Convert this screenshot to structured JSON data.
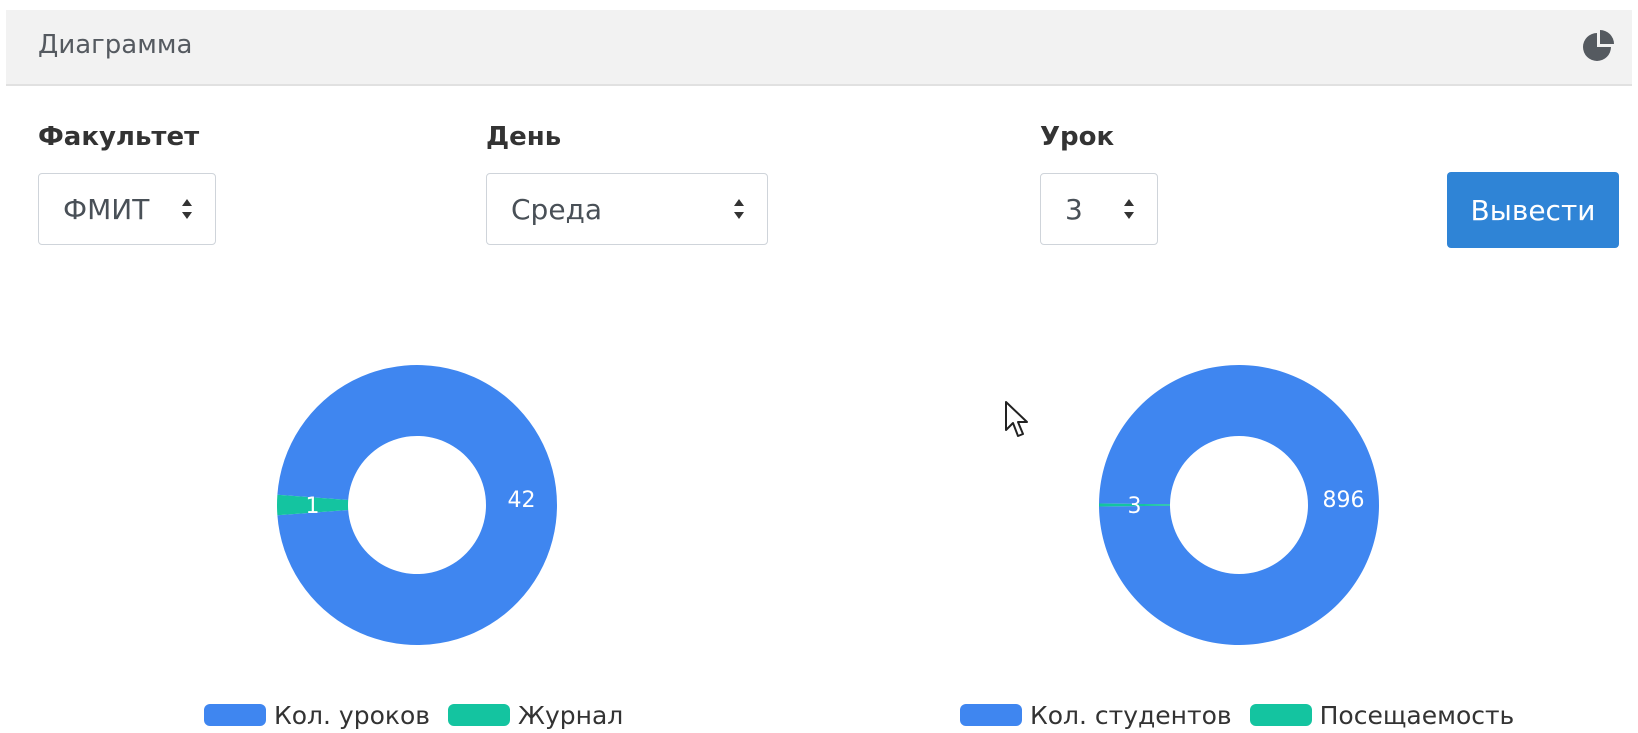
{
  "header": {
    "title": "Диаграмма",
    "icon": "pie-chart-icon"
  },
  "form": {
    "faculty": {
      "label": "Факультет",
      "value": "ФМИТ"
    },
    "day": {
      "label": "День",
      "value": "Среда"
    },
    "lesson": {
      "label": "Урок",
      "value": "3"
    },
    "submit_label": "Вывести"
  },
  "colors": {
    "blue": "#3f86f0",
    "teal": "#14c4a0",
    "button": "#2f84d6"
  },
  "chart_data": [
    {
      "type": "pie",
      "donut": true,
      "categories": [
        "Кол. уроков",
        "Журнал"
      ],
      "values": [
        42,
        1
      ],
      "colors": [
        "#3f86f0",
        "#14c4a0"
      ],
      "legend_position": "bottom"
    },
    {
      "type": "pie",
      "donut": true,
      "categories": [
        "Кол. студентов",
        "Посещаемость"
      ],
      "values": [
        896,
        3
      ],
      "colors": [
        "#3f86f0",
        "#14c4a0"
      ],
      "legend_position": "bottom"
    }
  ]
}
